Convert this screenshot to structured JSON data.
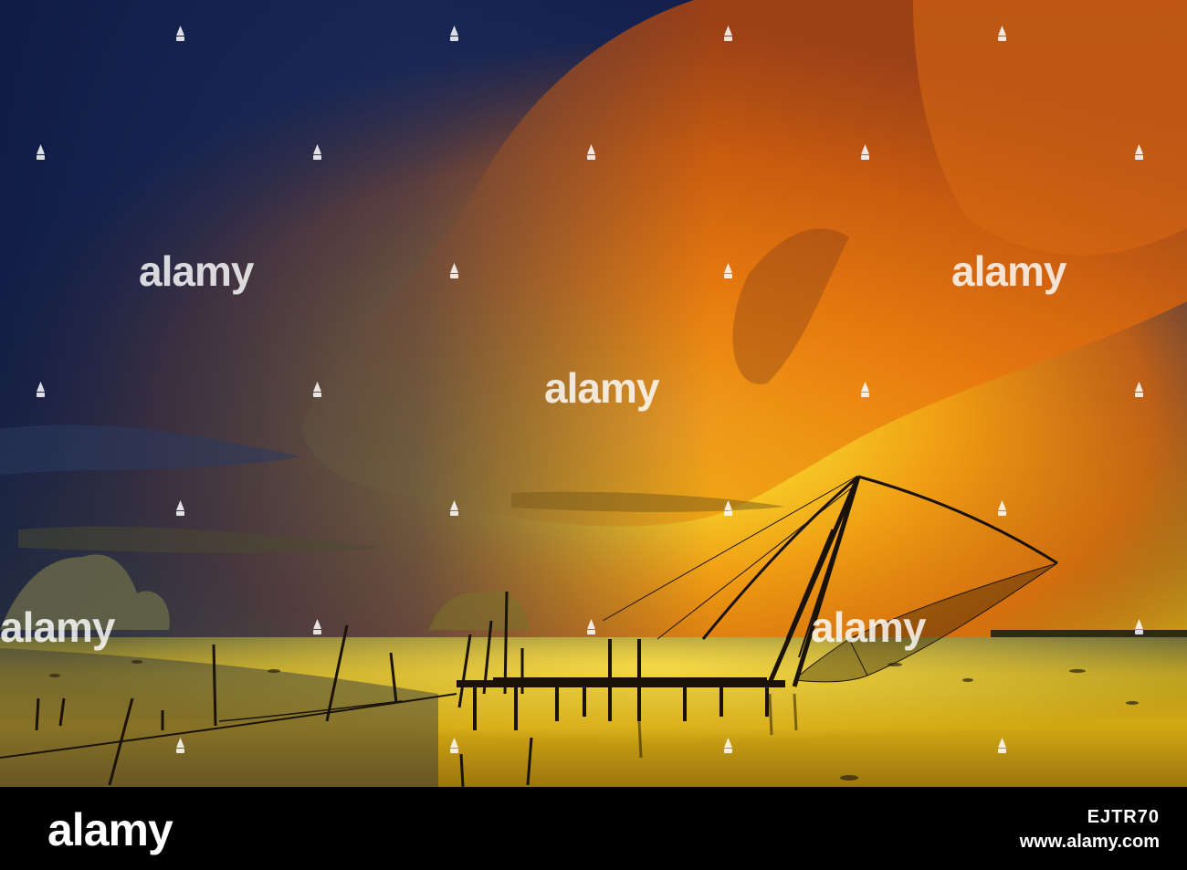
{
  "image": {
    "subject": "sunset-with-fishing-net",
    "colors": {
      "sky_dark": "#1b2c5a",
      "sky_orange": "#e8760e",
      "sky_yellow": "#f6c91a",
      "water": "#c59a10",
      "silhouette": "#1a1206"
    }
  },
  "watermark": {
    "text": "alamy"
  },
  "footer": {
    "logo": "alamy",
    "image_code": "EJTR70",
    "url": "www.alamy.com"
  }
}
